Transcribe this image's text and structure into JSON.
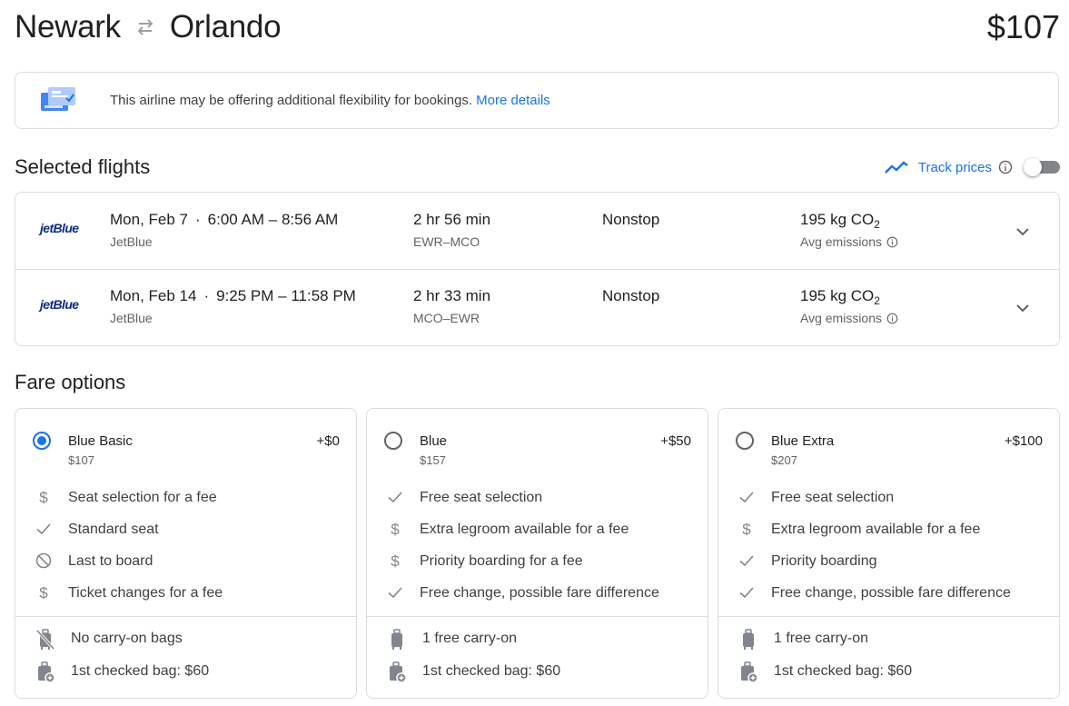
{
  "header": {
    "origin": "Newark",
    "destination": "Orlando",
    "total_price": "$107"
  },
  "banner": {
    "message": "This airline may be offering additional flexibility for bookings.",
    "link": "More details"
  },
  "selected_flights": {
    "title": "Selected flights",
    "track_prices_label": "Track prices",
    "flights": [
      {
        "airline_logo": "jetBlue",
        "date": "Mon, Feb 7",
        "times": "6:00 AM – 8:56 AM",
        "airline": "JetBlue",
        "duration": "2 hr 56 min",
        "route": "EWR–MCO",
        "stops": "Nonstop",
        "emissions": "195 kg CO",
        "emissions_sub": "2",
        "emissions_label": "Avg emissions"
      },
      {
        "airline_logo": "jetBlue",
        "date": "Mon, Feb 14",
        "times": "9:25 PM – 11:58 PM",
        "airline": "JetBlue",
        "duration": "2 hr 33 min",
        "route": "MCO–EWR",
        "stops": "Nonstop",
        "emissions": "195 kg CO",
        "emissions_sub": "2",
        "emissions_label": "Avg emissions"
      }
    ]
  },
  "fare_options": {
    "title": "Fare options",
    "fares": [
      {
        "name": "Blue Basic",
        "price": "$107",
        "delta": "+$0",
        "selected": true,
        "features": [
          {
            "icon": "dollar-icon",
            "text": "Seat selection for a fee"
          },
          {
            "icon": "check-icon",
            "text": "Standard seat"
          },
          {
            "icon": "block-icon",
            "text": "Last to board"
          },
          {
            "icon": "dollar-icon",
            "text": "Ticket changes for a fee"
          }
        ],
        "bags": [
          {
            "icon": "no-carry-on-icon",
            "text": "No carry-on bags"
          },
          {
            "icon": "checked-bag-icon",
            "text": "1st checked bag: $60"
          }
        ]
      },
      {
        "name": "Blue",
        "price": "$157",
        "delta": "+$50",
        "selected": false,
        "features": [
          {
            "icon": "check-icon",
            "text": "Free seat selection"
          },
          {
            "icon": "dollar-icon",
            "text": "Extra legroom available for a fee"
          },
          {
            "icon": "dollar-icon",
            "text": "Priority boarding for a fee"
          },
          {
            "icon": "check-icon",
            "text": "Free change, possible fare difference"
          }
        ],
        "bags": [
          {
            "icon": "carry-on-icon",
            "text": "1 free carry-on"
          },
          {
            "icon": "checked-bag-icon",
            "text": "1st checked bag: $60"
          }
        ]
      },
      {
        "name": "Blue Extra",
        "price": "$207",
        "delta": "+$100",
        "selected": false,
        "features": [
          {
            "icon": "check-icon",
            "text": "Free seat selection"
          },
          {
            "icon": "dollar-icon",
            "text": "Extra legroom available for a fee"
          },
          {
            "icon": "check-icon",
            "text": "Priority boarding"
          },
          {
            "icon": "check-icon",
            "text": "Free change, possible fare difference"
          }
        ],
        "bags": [
          {
            "icon": "carry-on-icon",
            "text": "1 free carry-on"
          },
          {
            "icon": "checked-bag-icon",
            "text": "1st checked bag: $60"
          }
        ]
      }
    ]
  },
  "colors": {
    "accent": "#1a73e8",
    "text": "#202124",
    "secondary_text": "#5f6368",
    "border": "#dadce0",
    "icon_gray": "#80868b",
    "airline_logo": "#0c2d83"
  }
}
